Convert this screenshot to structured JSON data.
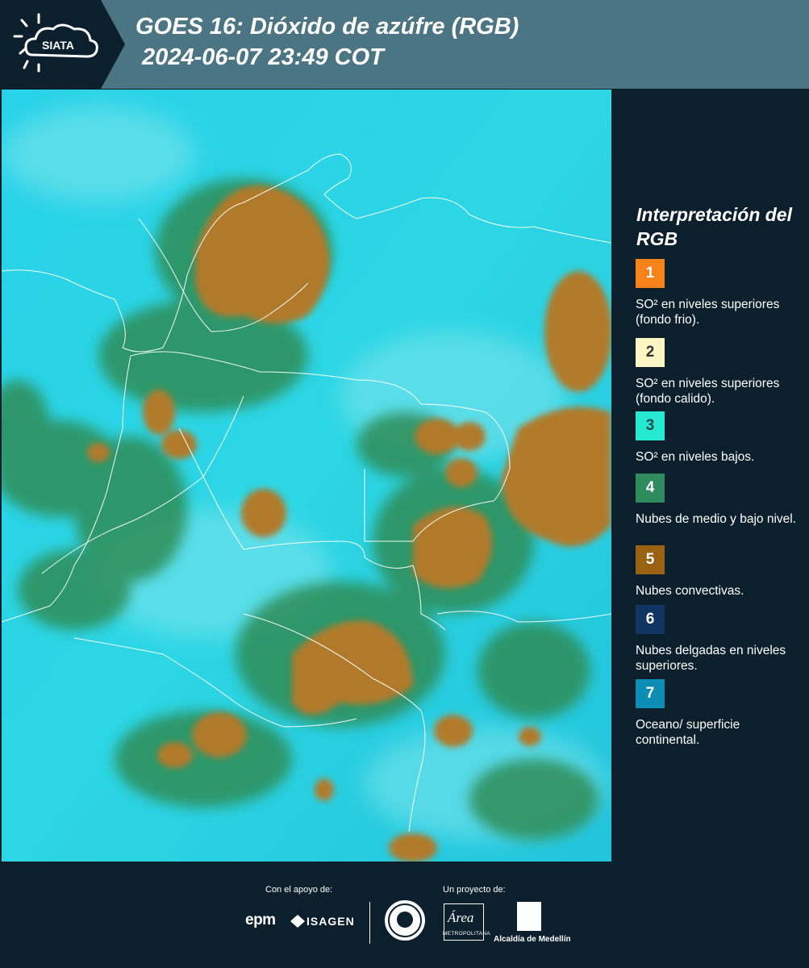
{
  "header": {
    "logo_text": "SIATA",
    "title_line1": "GOES 16: Dióxido de azúfre (RGB)",
    "title_line2": " 2024-06-07 23:49 COT"
  },
  "legend": {
    "title": "Interpretación del RGB",
    "items": [
      {
        "number": "1",
        "label": "SO² en niveles superiores (fondo frio).",
        "color": "#f7821c",
        "text_color": "#ffffff"
      },
      {
        "number": "2",
        "label": "SO² en niveles superiores (fondo calido).",
        "color": "#fdf6c4",
        "text_color": "#333333"
      },
      {
        "number": "3",
        "label": "SO² en niveles bajos.",
        "color": "#27e8d0",
        "text_color": "#1a4a4a"
      },
      {
        "number": "4",
        "label": "Nubes de medio y bajo nivel.",
        "color": "#2e8c5f",
        "text_color": "#ffffff"
      },
      {
        "number": "5",
        "label": "Nubes convectivas.",
        "color": "#9b6113",
        "text_color": "#ffffff"
      },
      {
        "number": "6",
        "label": "Nubes delgadas en niveles superiores.",
        "color": "#0f3563",
        "text_color": "#ffffff"
      },
      {
        "number": "7",
        "label": "Oceano/ superficie continental.",
        "color": "#0d8db5",
        "text_color": "#ffffff"
      }
    ]
  },
  "footer": {
    "support_label": "Con el apoyo de:",
    "project_label": "Un proyecto de:",
    "epm": "epm",
    "isagen": "ISAGEN",
    "area_logo": "Área",
    "area_sub": "METROPOLITANA",
    "alcaldia": "Alcaldía de Medellín"
  },
  "colors": {
    "header_bg": "#4c7584",
    "panel_bg": "#0b1f2c",
    "map_cyan": "#21c8e0",
    "map_green": "#2d8a5a",
    "map_orange": "#b07a2c"
  }
}
